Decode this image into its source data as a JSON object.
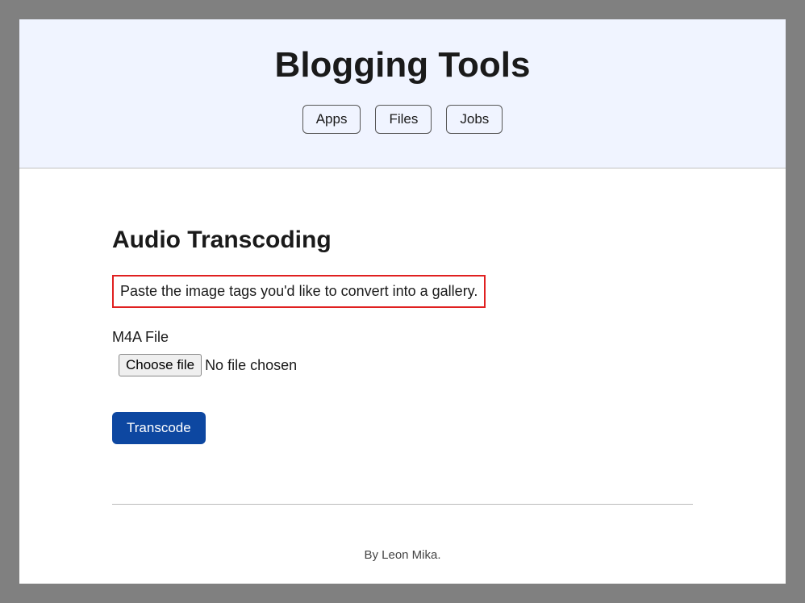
{
  "header": {
    "title": "Blogging Tools",
    "nav": {
      "apps": "Apps",
      "files": "Files",
      "jobs": "Jobs"
    }
  },
  "main": {
    "heading": "Audio Transcoding",
    "description": "Paste the image tags you'd like to convert into a gallery.",
    "file_field": {
      "label": "M4A File",
      "choose_button": "Choose file",
      "status": "No file chosen"
    },
    "submit_label": "Transcode"
  },
  "footer": {
    "byline": "By Leon Mika."
  }
}
